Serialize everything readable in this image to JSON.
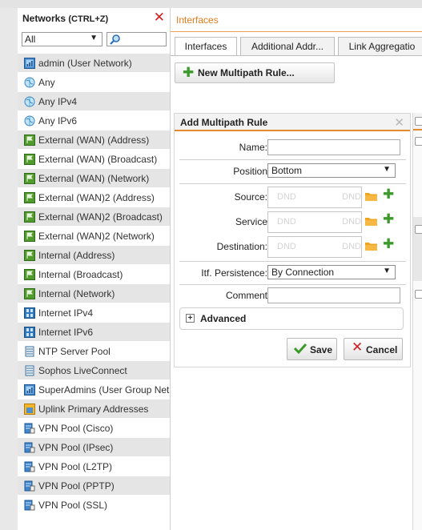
{
  "networks_panel": {
    "title": "Networks",
    "shortcut": "(CTRL+Z)",
    "filter_value": "All",
    "search_value": "",
    "items": [
      {
        "label": "admin (User Network)",
        "icon": "user-network-icon"
      },
      {
        "label": "Any",
        "icon": "globe-icon"
      },
      {
        "label": "Any IPv4",
        "icon": "globe-icon"
      },
      {
        "label": "Any IPv6",
        "icon": "globe-icon"
      },
      {
        "label": "External (WAN) (Address)",
        "icon": "green-flag-icon"
      },
      {
        "label": "External (WAN) (Broadcast)",
        "icon": "green-flag-icon"
      },
      {
        "label": "External (WAN) (Network)",
        "icon": "green-flag-icon"
      },
      {
        "label": "External (WAN)2 (Address)",
        "icon": "green-flag-icon"
      },
      {
        "label": "External (WAN)2 (Broadcast)",
        "icon": "green-flag-icon"
      },
      {
        "label": "External (WAN)2 (Network)",
        "icon": "green-flag-icon"
      },
      {
        "label": "Internal (Address)",
        "icon": "green-flag-icon"
      },
      {
        "label": "Internal (Broadcast)",
        "icon": "green-flag-icon"
      },
      {
        "label": "Internal (Network)",
        "icon": "green-flag-icon"
      },
      {
        "label": "Internet IPv4",
        "icon": "internet-icon"
      },
      {
        "label": "Internet IPv6",
        "icon": "internet-icon"
      },
      {
        "label": "NTP Server Pool",
        "icon": "server-pool-icon"
      },
      {
        "label": "Sophos LiveConnect",
        "icon": "server-pool-icon"
      },
      {
        "label": "SuperAdmins (User Group Net",
        "icon": "user-network-icon"
      },
      {
        "label": "Uplink Primary Addresses",
        "icon": "uplink-icon"
      },
      {
        "label": "VPN Pool (Cisco)",
        "icon": "vpn-pool-icon"
      },
      {
        "label": "VPN Pool (IPsec)",
        "icon": "vpn-pool-icon"
      },
      {
        "label": "VPN Pool (L2TP)",
        "icon": "vpn-pool-icon"
      },
      {
        "label": "VPN Pool (PPTP)",
        "icon": "vpn-pool-icon"
      },
      {
        "label": "VPN Pool (SSL)",
        "icon": "vpn-pool-icon"
      }
    ]
  },
  "page": {
    "title": "Interfaces",
    "tabs": [
      "Interfaces",
      "Additional Addr...",
      "Link Aggregatio"
    ],
    "new_rule_label": "New Multipath Rule..."
  },
  "dialog": {
    "title": "Add Multipath Rule",
    "name_label": "Name:",
    "name_value": "",
    "position_label": "Position",
    "position_value": "Bottom",
    "source_label": "Source:",
    "service_label": "Service",
    "destination_label": "Destination:",
    "dnd_text": "DND",
    "persistence_label": "Itf. Persistence:",
    "persistence_value": "By Connection",
    "comment_label": "Comment",
    "comment_value": "",
    "advanced_label": "Advanced",
    "save_label": "Save",
    "cancel_label": "Cancel"
  },
  "colors": {
    "accent_orange": "#e07b1a",
    "add_green": "#3a9a2a",
    "close_red": "#d02020"
  }
}
